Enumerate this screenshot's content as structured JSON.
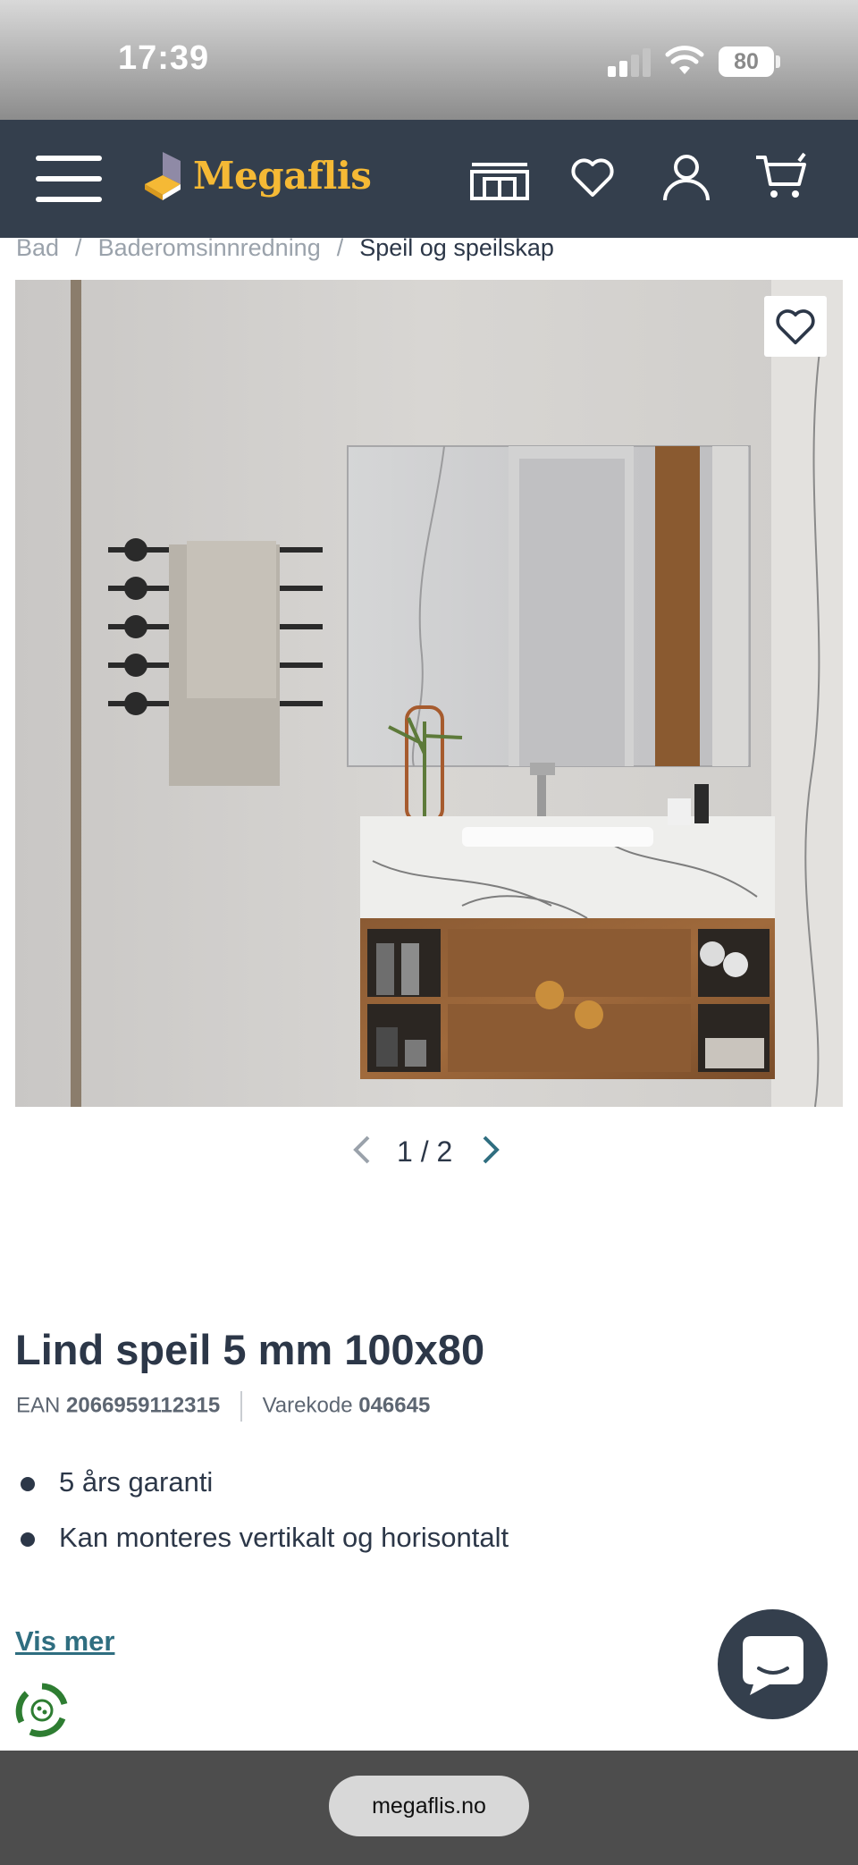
{
  "status_bar": {
    "time": "17:39",
    "battery": "80"
  },
  "header": {
    "logo_text": "Megaflis",
    "colors": {
      "background": "#343f4d",
      "logo_text": "#f5b935",
      "icons": "#ffffff"
    },
    "icons": [
      "menu-icon",
      "showroom-icon",
      "heart-icon",
      "user-icon",
      "cart-icon"
    ]
  },
  "breadcrumb": {
    "items": [
      "Bad",
      "Baderomsinnredning",
      "Speil og speilskap"
    ],
    "separator": "/"
  },
  "gallery": {
    "current": "1",
    "separator": "/",
    "total": "2"
  },
  "product": {
    "title": "Lind speil 5 mm 100x80",
    "ean_label": "EAN",
    "ean": "2066959112315",
    "sku_label": "Varekode",
    "sku": "046645",
    "features": [
      "5 års garanti",
      "Kan monteres vertikalt og horisontalt"
    ],
    "see_more": "Vis mer"
  },
  "colors": {
    "accent_link": "#2f6e80",
    "text": "#2c3748",
    "recycle": "#2e7d32"
  },
  "browser": {
    "url": "megaflis.no"
  }
}
